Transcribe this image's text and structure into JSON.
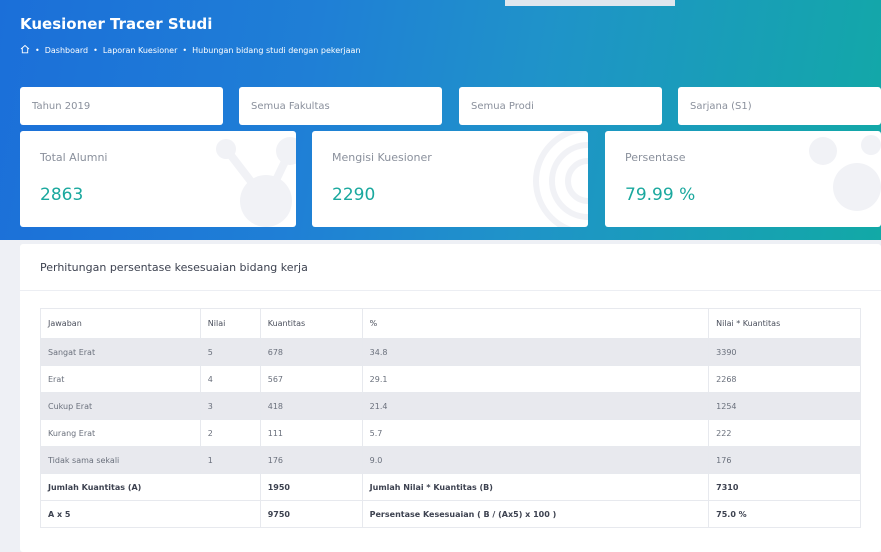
{
  "header": {
    "title": "Kuesioner Tracer Studi",
    "breadcrumb": [
      "Dashboard",
      "Laporan Kuesioner",
      "Hubungan bidang studi dengan pekerjaan"
    ]
  },
  "filters": {
    "year": "Tahun 2019",
    "faculty": "Semua Fakultas",
    "prodi": "Semua Prodi",
    "degree": "Sarjana (S1)"
  },
  "stats": [
    {
      "label": "Total Alumni",
      "value": "2863"
    },
    {
      "label": "Mengisi Kuesioner",
      "value": "2290"
    },
    {
      "label": "Persentase",
      "value": "79.99 %"
    }
  ],
  "colors": {
    "accent": "#1aa89e",
    "header_start": "#1b6fd9",
    "header_end": "#12a9a6"
  },
  "table": {
    "title": "Perhitungan persentase kesesuaian bidang kerja",
    "headers": [
      "Jawaban",
      "Nilai",
      "Kuantitas",
      "%",
      "Nilai * Kuantitas"
    ],
    "rows": [
      [
        "Sangat Erat",
        "5",
        "678",
        "34.8",
        "3390"
      ],
      [
        "Erat",
        "4",
        "567",
        "29.1",
        "2268"
      ],
      [
        "Cukup Erat",
        "3",
        "418",
        "21.4",
        "1254"
      ],
      [
        "Kurang Erat",
        "2",
        "111",
        "5.7",
        "222"
      ],
      [
        "Tidak sama sekali",
        "1",
        "176",
        "9.0",
        "176"
      ]
    ],
    "summary": [
      [
        "Jumlah Kuantitas (A)",
        "1950",
        "Jumlah Nilai * Kuantitas (B)",
        "7310"
      ],
      [
        "A x 5",
        "9750",
        "Persentase Kesesuaian ( B / (Ax5) x 100 )",
        "75.0 %"
      ]
    ]
  }
}
